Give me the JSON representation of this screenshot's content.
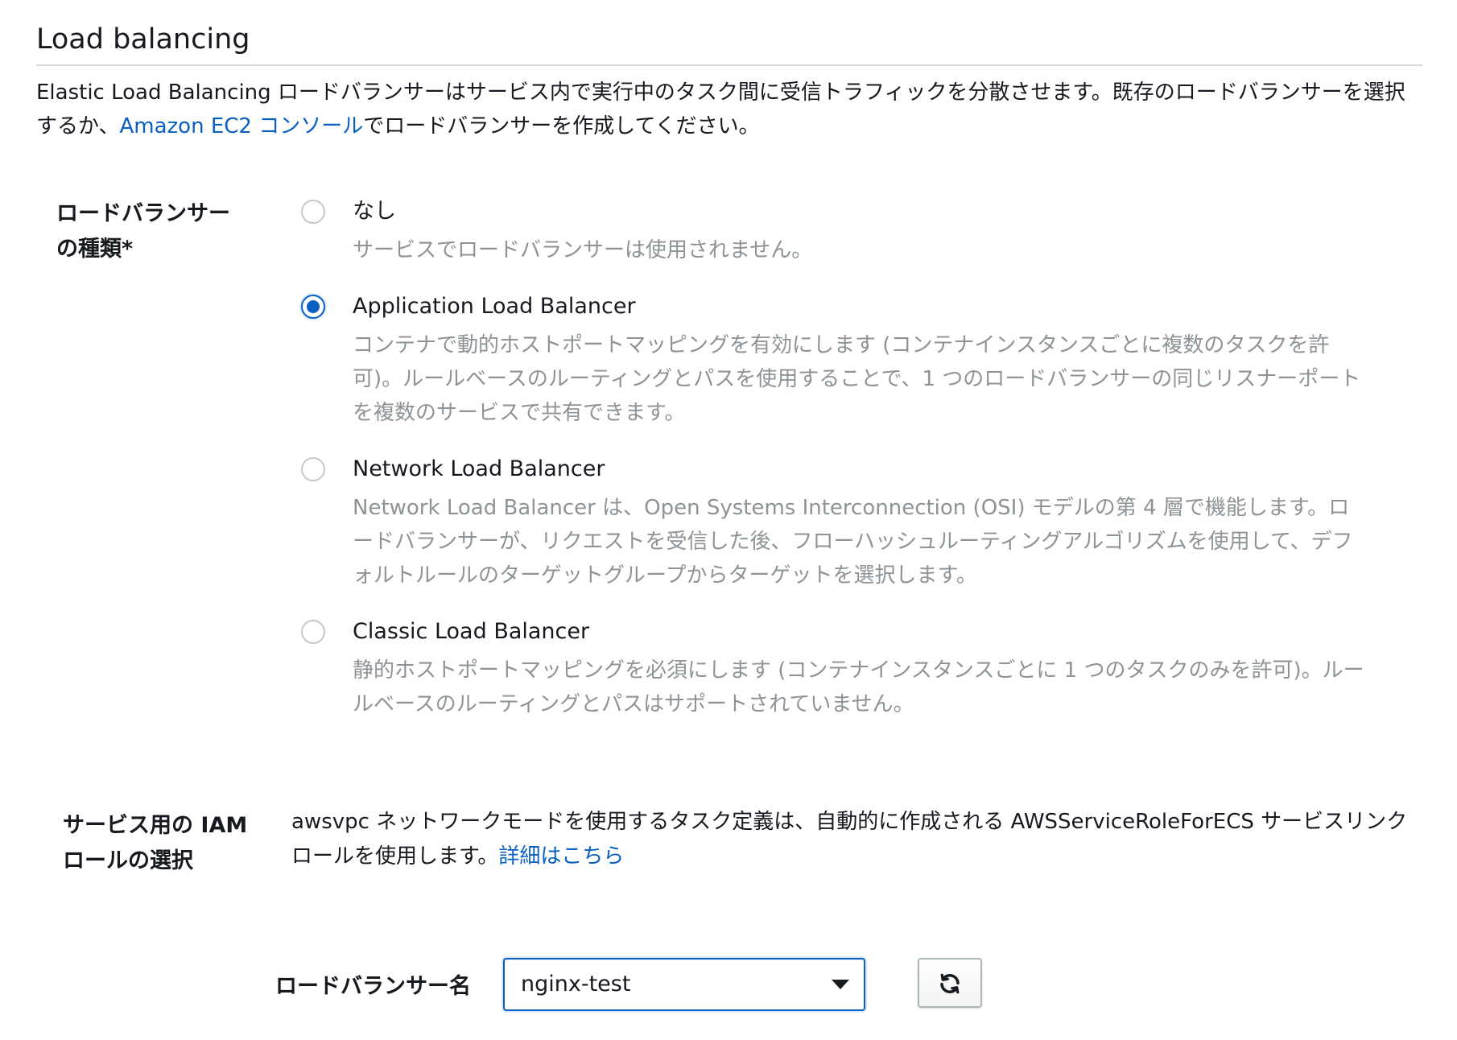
{
  "section": {
    "title": "Load balancing",
    "intro_before_link": "Elastic Load Balancing ロードバランサーはサービス内で実行中のタスク間に受信トラフィックを分散させます。既存のロードバランサーを選択するか、",
    "intro_link": "Amazon EC2 コンソール",
    "intro_after_link": "でロードバランサーを作成してください。"
  },
  "lb_type": {
    "label": "ロードバランサーの種類*",
    "selected": "Application Load Balancer",
    "options": [
      {
        "label": "なし",
        "description": "サービスでロードバランサーは使用されません。",
        "checked": false
      },
      {
        "label": "Application Load Balancer",
        "description": "コンテナで動的ホストポートマッピングを有効にします (コンテナインスタンスごとに複数のタスクを許可)。ルールベースのルーティングとパスを使用することで、1 つのロードバランサーの同じリスナーポートを複数のサービスで共有できます。",
        "checked": true
      },
      {
        "label": "Network Load Balancer",
        "description": "Network Load Balancer は、Open Systems Interconnection (OSI) モデルの第 4 層で機能します。ロードバランサーが、リクエストを受信した後、フローハッシュルーティングアルゴリズムを使用して、デフォルトルールのターゲットグループからターゲットを選択します。",
        "checked": false
      },
      {
        "label": "Classic Load Balancer",
        "description": "静的ホストポートマッピングを必須にします (コンテナインスタンスごとに 1 つのタスクのみを許可)。ルールベースのルーティングとパスはサポートされていません。",
        "checked": false
      }
    ]
  },
  "iam": {
    "label": "サービス用の IAM ロールの選択",
    "text": "awsvpc ネットワークモードを使用するタスク定義は、自動的に作成される AWSServiceRoleForECS サービスリンクロールを使用します。",
    "link": "詳細はこちら"
  },
  "lb_name": {
    "label": "ロードバランサー名",
    "value": "nginx-test",
    "refresh_icon": "refresh-icon"
  },
  "colors": {
    "accent": "#0a60c2",
    "muted_text": "#8d9396",
    "text": "#16191f"
  }
}
